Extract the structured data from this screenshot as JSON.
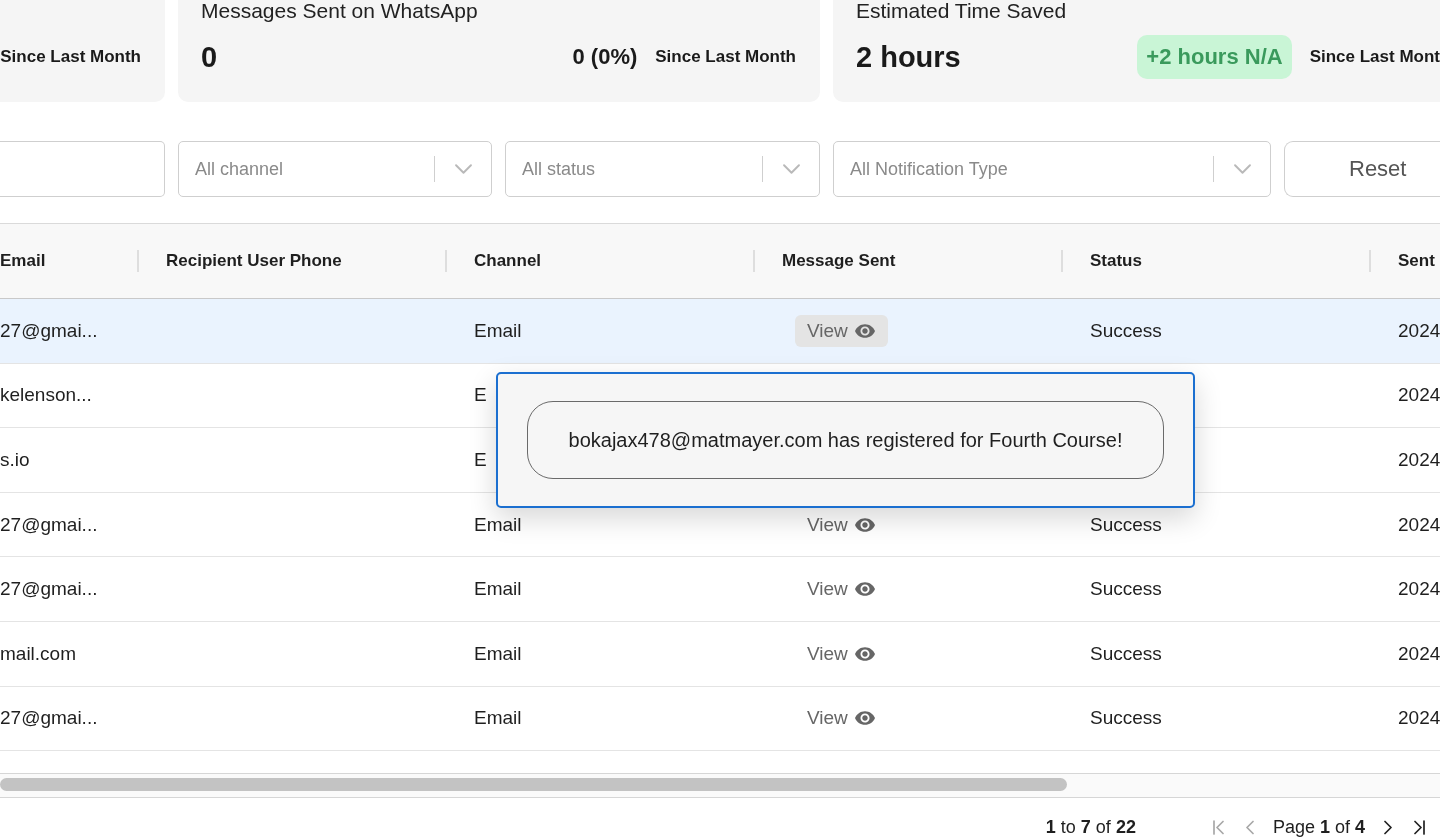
{
  "stat_cards": [
    {
      "caption": "Since Last Month"
    },
    {
      "title": "Messages Sent on WhatsApp",
      "value": "0",
      "change": "0 (0%)",
      "positive": false,
      "caption": "Since Last Month"
    },
    {
      "title": "Estimated Time Saved",
      "value": "2 hours",
      "change": "+2 hours N/A",
      "positive": true,
      "caption": "Since Last Mont"
    }
  ],
  "filters": [
    {
      "kind": "input"
    },
    {
      "kind": "select",
      "placeholder": "All channel"
    },
    {
      "kind": "select",
      "placeholder": "All status"
    },
    {
      "kind": "select",
      "placeholder": "All Notification Type"
    }
  ],
  "reset_button": "Reset",
  "table": {
    "columns": [
      "Email",
      "Recipient User Phone",
      "Channel",
      "Message Sent",
      "Status",
      "Sent"
    ],
    "rows": [
      {
        "selected": true,
        "email": "27@gmai...",
        "channel": "Email",
        "message_sent": {
          "label": "View",
          "active": true
        },
        "status": "Success",
        "sent": "2024"
      },
      {
        "selected": false,
        "email": "kelenson...",
        "channel": "E",
        "sent": "2024"
      },
      {
        "selected": false,
        "email": "s.io",
        "channel": "E",
        "sent": "2024"
      },
      {
        "selected": false,
        "email": "27@gmai...",
        "channel": "Email",
        "message_sent": {
          "label": "View",
          "active": false
        },
        "status": "Success",
        "sent": "2024"
      },
      {
        "selected": false,
        "email": "27@gmai...",
        "channel": "Email",
        "message_sent": {
          "label": "View",
          "active": false
        },
        "status": "Success",
        "sent": "2024"
      },
      {
        "selected": false,
        "email": "mail.com",
        "channel": "Email",
        "message_sent": {
          "label": "View",
          "active": false
        },
        "status": "Success",
        "sent": "2024"
      },
      {
        "selected": false,
        "email": "27@gmai...",
        "channel": "Email",
        "message_sent": {
          "label": "View",
          "active": false
        },
        "status": "Success",
        "sent": "2024"
      }
    ]
  },
  "popover": {
    "message": "bokajax478@matmayer.com has registered for Fourth Course!"
  },
  "pagination": {
    "range": "**1** to **7** of **22**",
    "page": "Page **1** of **4**",
    "buttons": [
      {
        "kind": "first",
        "disabled": true
      },
      {
        "kind": "previous",
        "disabled": true
      },
      {
        "kind": "next",
        "disabled": false
      },
      {
        "kind": "last",
        "disabled": false
      }
    ]
  }
}
